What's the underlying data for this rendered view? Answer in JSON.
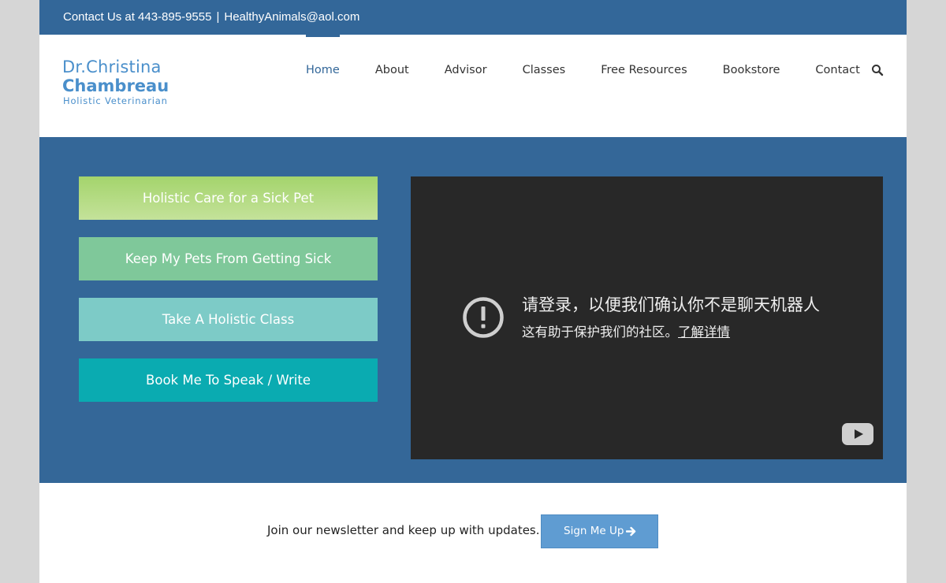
{
  "topbar": {
    "contact_text": "Contact Us at 443-895-9555",
    "separator": "|",
    "email": "HealthyAnimals@aol.com"
  },
  "logo": {
    "line1": "Dr.Christina",
    "line2": "Chambreau",
    "line3": "Holistic Veterinarian"
  },
  "nav": {
    "items": [
      "Home",
      "About",
      "Advisor",
      "Classes",
      "Free Resources",
      "Bookstore",
      "Contact"
    ],
    "active": "Home",
    "search_icon": "search-icon"
  },
  "hero": {
    "buttons": [
      "Holistic Care for a Sick Pet",
      "Keep My Pets From Getting Sick",
      "Take A Holistic Class",
      "Book Me To Speak / Write"
    ],
    "video": {
      "title": "请登录，以便我们确认你不是聊天机器人",
      "subtitle": "这有助于保护我们的社区。",
      "link": "了解详情",
      "warning_icon": "exclamation-circle-icon",
      "logo_icon": "youtube-play-icon"
    }
  },
  "newsletter": {
    "text": "Join our newsletter and keep up with updates.",
    "button_label": "Sign Me Up",
    "button_icon": "arrow-right-icon"
  },
  "colors": {
    "brand_blue": "#336799",
    "logo_blue": "#4a8fcb",
    "cta_green": "#a4d46c",
    "cta_mint": "#7fc89a",
    "cta_aqua": "#7dcbc7",
    "cta_teal": "#0aabb1",
    "signup_blue": "#5f9cd2"
  }
}
